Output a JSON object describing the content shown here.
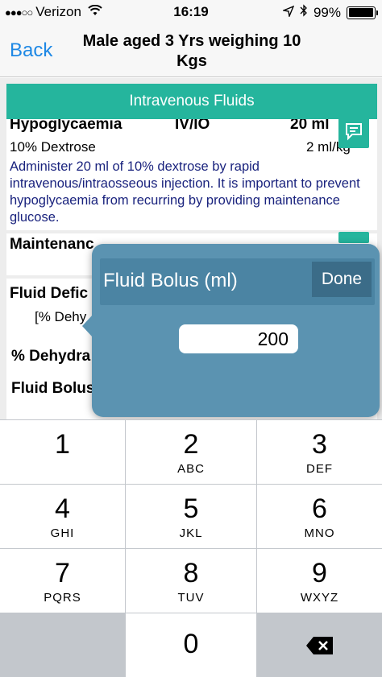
{
  "status_bar": {
    "carrier": "Verizon",
    "time": "16:19",
    "battery": "99%",
    "battery_level": 0.99
  },
  "nav": {
    "back_label": "Back",
    "title": "Male aged 3 Yrs weighing 10 Kgs"
  },
  "section": {
    "title": "Intravenous Fluids"
  },
  "hypoglycaemia": {
    "name": "Hypoglycaemia",
    "route": "IV/IO",
    "amount": "20 ml",
    "fluid": "10% Dextrose",
    "dose": "2 ml/kg",
    "note": "Administer 20 ml of 10% dextrose by rapid intravenous/intraosseous injection. It is important to prevent hypoglycaemia from recurring by providing maintenance glucose."
  },
  "maintenance": {
    "name": "Maintenanc"
  },
  "fluid_deficit": {
    "label": "Fluid Defic",
    "sub": "[% Dehy",
    "pct_label": "% Dehydra",
    "bolus_label": "Fluid Bolus"
  },
  "popover": {
    "title": "Fluid Bolus (ml)",
    "done_label": "Done",
    "value": "200"
  },
  "keypad": {
    "keys": [
      {
        "num": "1",
        "letters": ""
      },
      {
        "num": "2",
        "letters": "ABC"
      },
      {
        "num": "3",
        "letters": "DEF"
      },
      {
        "num": "4",
        "letters": "GHI"
      },
      {
        "num": "5",
        "letters": "JKL"
      },
      {
        "num": "6",
        "letters": "MNO"
      },
      {
        "num": "7",
        "letters": "PQRS"
      },
      {
        "num": "8",
        "letters": "TUV"
      },
      {
        "num": "9",
        "letters": "WXYZ"
      },
      {
        "num": "0",
        "letters": ""
      }
    ]
  },
  "colors": {
    "accent": "#25b59d",
    "link": "#1e88e5",
    "popover": "#5b93b1",
    "note_text": "#1a237e"
  }
}
